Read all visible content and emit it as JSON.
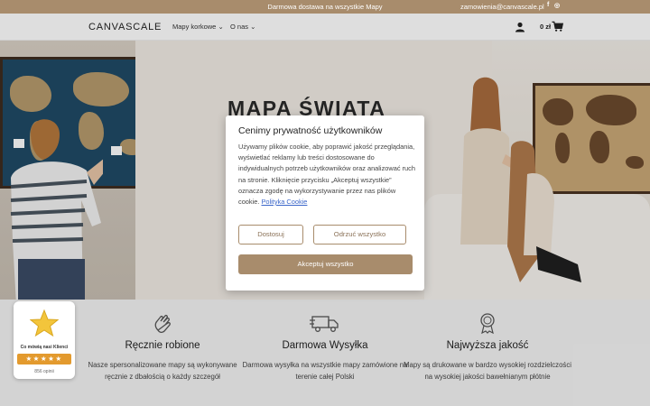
{
  "topbar": {
    "promo": "Darmowa dostawa na wszystkie Mapy",
    "email": "zamowienia@canvascale.pl",
    "social": [
      "f",
      "◎"
    ]
  },
  "header": {
    "logo": "CANVASCALE",
    "nav": [
      "Mapy korkowe",
      "O nas"
    ],
    "cart_total": "0 zł"
  },
  "hero": {
    "title": "MAPA ŚWIATA"
  },
  "features": [
    {
      "icon": "hand-icon",
      "title": "Ręcznie robione",
      "text": "Nasze spersonalizowane mapy są wykonywane ręcznie z dbałością o każdy szczegół"
    },
    {
      "icon": "truck-icon",
      "title": "Darmowa Wysyłka",
      "text": "Darmowa wysyłka na wszystkie mapy zamówione na terenie całej Polski"
    },
    {
      "icon": "quality-badge-icon",
      "title": "Najwyższa jakość",
      "text": "Mapy są drukowane w bardzo wysokiej rozdzielczości na wysokiej jakości bawełnianym płótnie"
    }
  ],
  "reviews": {
    "title": "Co mówią nasi Klienci",
    "stars": "★★★★★",
    "count": "856 opinii"
  },
  "cookie": {
    "title": "Cenimy prywatność użytkowników",
    "body": "Używamy plików cookie, aby poprawić jakość przeglądania, wyświetlać reklamy lub treści dostosowane do indywidualnych potrzeb użytkowników oraz analizować ruch na stronie. Kliknięcie przycisku „Akceptuj wszystkie” oznacza zgodę na wykorzystywanie przez nas plików cookie.",
    "policy_link": "Polityka Cookie",
    "customize": "Dostosuj",
    "reject": "Odrzuć wszystko",
    "accept": "Akceptuj wszystko"
  },
  "colors": {
    "brand": "#a88c6c",
    "review_orange": "#e39a2e",
    "link": "#3b66c9"
  }
}
